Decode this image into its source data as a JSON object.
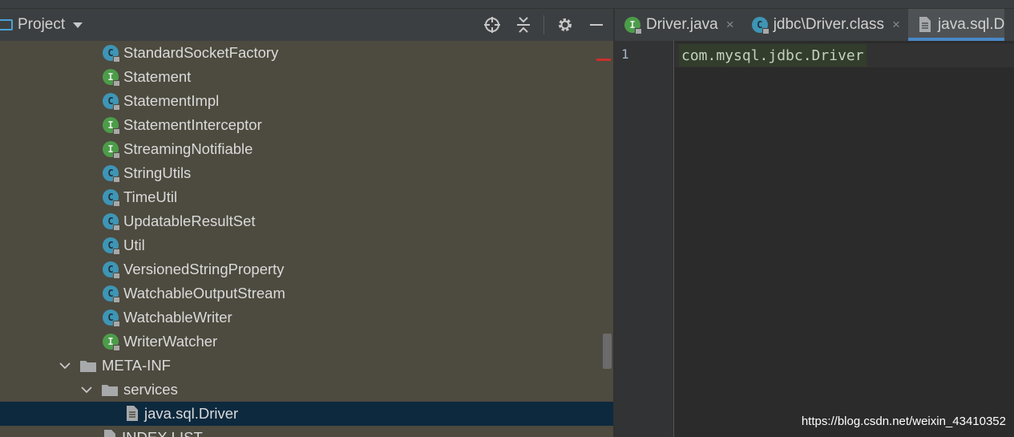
{
  "panel": {
    "title": "Project",
    "tree": [
      {
        "label": "StandardSocketFactory",
        "kind": "class"
      },
      {
        "label": "Statement",
        "kind": "interface"
      },
      {
        "label": "StatementImpl",
        "kind": "class"
      },
      {
        "label": "StatementInterceptor",
        "kind": "interface"
      },
      {
        "label": "StreamingNotifiable",
        "kind": "interface"
      },
      {
        "label": "StringUtils",
        "kind": "class"
      },
      {
        "label": "TimeUtil",
        "kind": "class"
      },
      {
        "label": "UpdatableResultSet",
        "kind": "class"
      },
      {
        "label": "Util",
        "kind": "class"
      },
      {
        "label": "VersionedStringProperty",
        "kind": "class"
      },
      {
        "label": "WatchableOutputStream",
        "kind": "class"
      },
      {
        "label": "WatchableWriter",
        "kind": "class"
      },
      {
        "label": "WriterWatcher",
        "kind": "interface"
      },
      {
        "label": "META-INF",
        "kind": "folder"
      },
      {
        "label": "services",
        "kind": "folder"
      },
      {
        "label": "java.sql.Driver",
        "kind": "file"
      },
      {
        "label": "INDEX.LIST",
        "kind": "file"
      }
    ]
  },
  "editor": {
    "tabs": [
      {
        "label": "Driver.java",
        "icon": "interface-icon",
        "close": "×"
      },
      {
        "label": "jdbc\\Driver.class",
        "icon": "class-icon",
        "close": "×"
      },
      {
        "label": "java.sql.D",
        "icon": "text-file-icon",
        "close": ""
      }
    ],
    "line_number": "1",
    "code": "com.mysql.jdbc.Driver"
  },
  "watermark": "https://blog.csdn.net/weixin_43410352",
  "colors": {
    "panel_bg": "#4d4a3f",
    "selected_row": "#0d293e",
    "class_icon": "#3e95b5",
    "interface_icon": "#4d9c4a",
    "active_tab_underline": "#4a88c7"
  }
}
